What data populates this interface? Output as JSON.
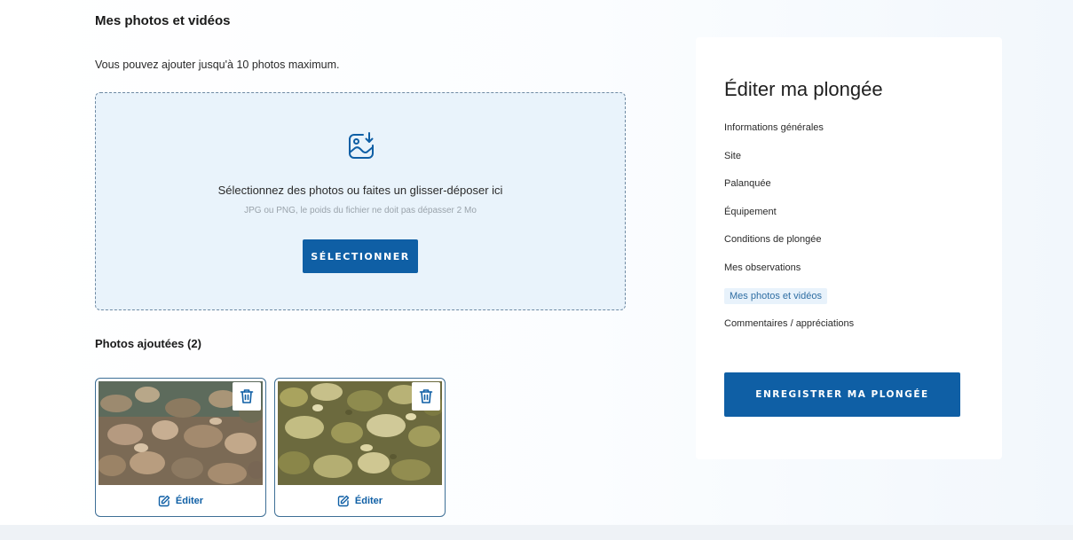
{
  "section": {
    "title": "Mes photos et vidéos",
    "description": "Vous pouvez ajouter jusqu'à 10 photos maximum."
  },
  "dropzone": {
    "icon": "image-download-icon",
    "main_text": "Sélectionnez des photos ou faites un glisser-déposer ici",
    "sub_text": "JPG ou PNG, le poids du fichier ne doit pas dépasser 2 Mo",
    "button_label": "SÉLECTIONNER"
  },
  "added": {
    "title": "Photos ajoutées (2)",
    "photos": [
      {
        "edit_label": "Éditer",
        "delete_icon": "trash-icon",
        "edit_icon": "edit-icon"
      },
      {
        "edit_label": "Éditer",
        "delete_icon": "trash-icon",
        "edit_icon": "edit-icon"
      }
    ]
  },
  "sidebar": {
    "title": "Éditer ma plongée",
    "items": [
      {
        "label": "Informations générales"
      },
      {
        "label": "Site"
      },
      {
        "label": "Palanquée"
      },
      {
        "label": "Équipement"
      },
      {
        "label": "Conditions de plongée"
      },
      {
        "label": "Mes observations"
      },
      {
        "label": "Mes photos et vidéos",
        "active": true
      },
      {
        "label": "Commentaires / appréciations"
      }
    ],
    "save_label": "ENREGISTRER MA PLONGÉE"
  },
  "colors": {
    "primary": "#0f5fa5",
    "dropzone_bg": "#e9f3fb",
    "active_item_bg": "#e8f2fb"
  }
}
